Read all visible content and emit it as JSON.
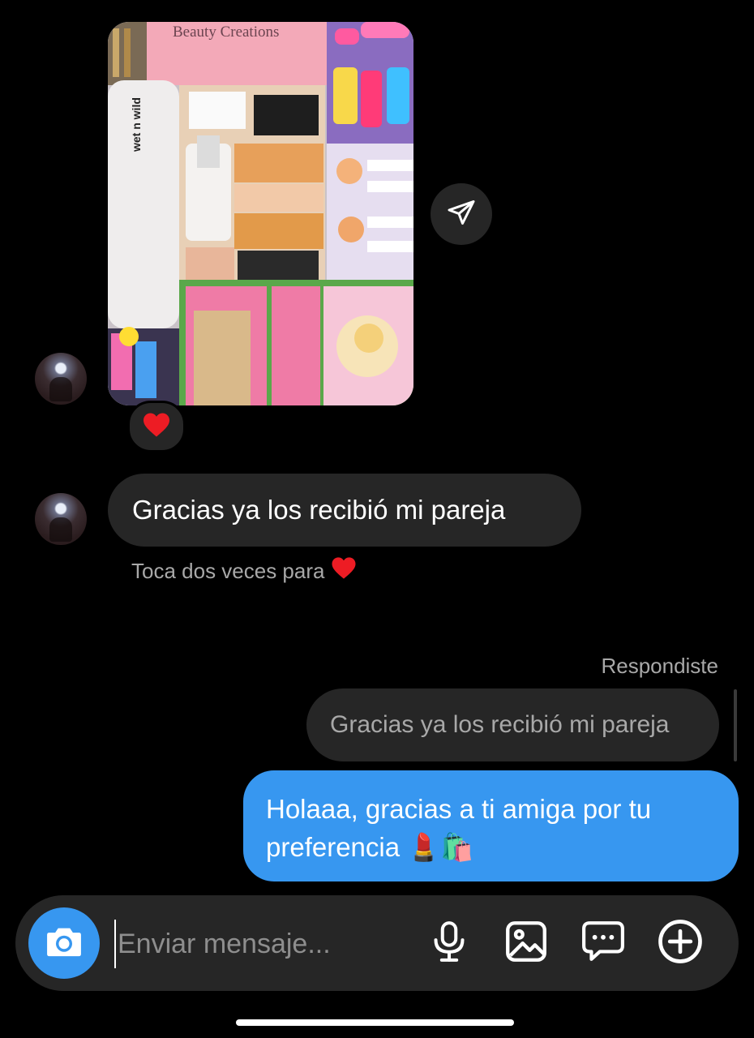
{
  "conversation": {
    "shared_post": {
      "brand_label": "Beauty Creations",
      "side_label": "wet n wild",
      "reaction": "❤️"
    },
    "incoming_message": "Gracias ya los recibió mi pareja",
    "double_tap_hint": "Toca dos veces para",
    "double_tap_emoji": "❤️",
    "replied_label": "Respondiste",
    "quoted_message": "Gracias ya los recibió mi pareja",
    "outgoing_message_line1": "Holaaa, gracias a ti amiga por tu",
    "outgoing_message_line2": "preferencia 💄🛍️"
  },
  "composer": {
    "placeholder": "Enviar mensaje...",
    "icons": [
      "camera-icon",
      "microphone-icon",
      "gallery-icon",
      "sticker-icon",
      "plus-icon"
    ]
  },
  "colors": {
    "background": "#000000",
    "incoming_bubble": "#262626",
    "outgoing_bubble": "#3797f0",
    "muted_text": "#a8a8a8"
  }
}
